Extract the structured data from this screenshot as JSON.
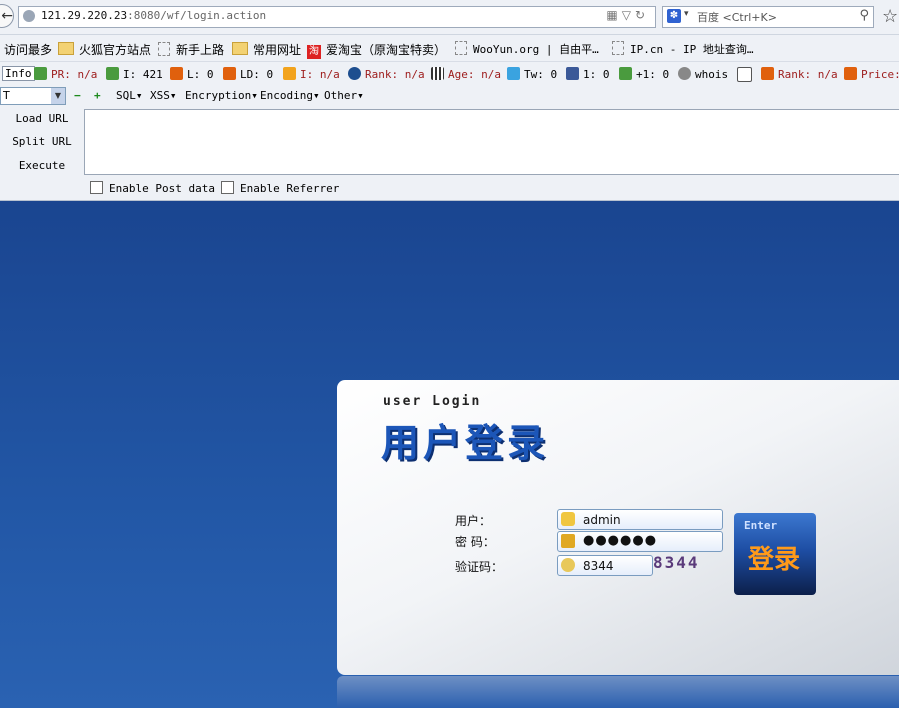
{
  "browser": {
    "url_host": "121.29.220.23",
    "url_rest": ":8080/wf/login.action",
    "search_engine": "百度",
    "search_hint": "<Ctrl+K>"
  },
  "bookmarks": [
    "访问最多",
    "火狐官方站点",
    "新手上路",
    "常用网址",
    "爱淘宝（原淘宝特卖）",
    "WooYun.org | 自由平…",
    "IP.cn - IP 地址查询…"
  ],
  "seo": {
    "info": "Info",
    "pr": "PR: n/a",
    "i1": "I: 421",
    "l": "L: 0",
    "ld": "LD: 0",
    "i2": "I: n/a",
    "rank1": "Rank: n/a",
    "age": "Age: n/a",
    "tw": "Tw: 0",
    "fb": "1: 0",
    "gplus": "+1: 0",
    "whois": "whois",
    "rank2": "Rank: n/a",
    "price": "Price:"
  },
  "hackbar": {
    "select_value": "T",
    "menus": [
      "SQL▾",
      "XSS▾",
      "Encryption▾",
      "Encoding▾",
      "Other▾"
    ],
    "load_url": "Load URL",
    "split_url": "Split URL",
    "execute": "Execute",
    "enable_post": "Enable Post data",
    "enable_referrer": "Enable Referrer"
  },
  "login": {
    "title_en": "user Login",
    "title_cn": "用户登录",
    "user_label": "用户：",
    "user_value": "admin",
    "password_label": "密 码：",
    "password_mask": "●●●●●●",
    "captcha_label": "验证码：",
    "captcha_value": "8344",
    "captcha_image_text": "8344",
    "enter_en": "Enter",
    "enter_cn": "登录"
  }
}
